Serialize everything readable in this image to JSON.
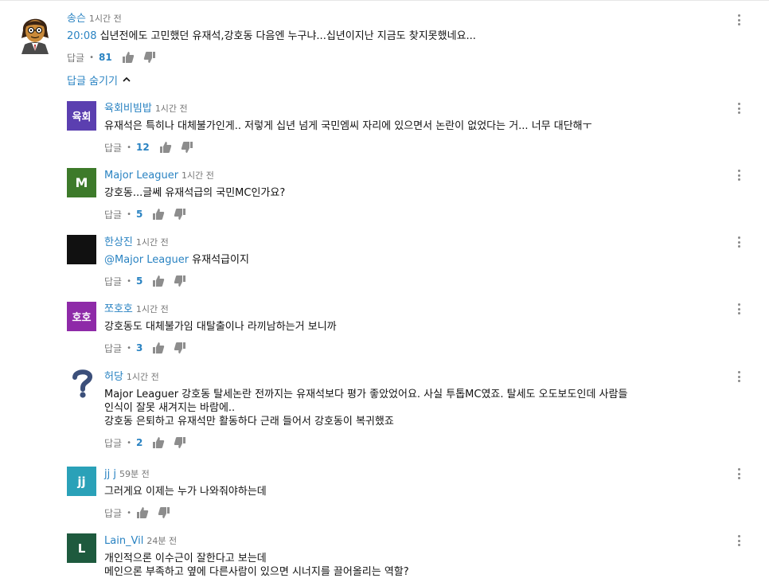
{
  "thread": {
    "author": "송슨",
    "time": "1시간 전",
    "timestamp_link": "20:08",
    "text": " 십년전에도 고민했던 유재석,강호동 다음엔 누구냐...십년이지난 지금도 찾지못했네요...",
    "reply_label": "답글",
    "likes": "81",
    "hide_replies_label": "답글 숨기기"
  },
  "replies": [
    {
      "author": "육회비빔밥",
      "time": "1시간 전",
      "avatar_text": "육회",
      "avatar_color": "#5b3fb0",
      "lines": [
        "유재석은 특히나 대체불가인게.. 저렇게 십년 넘게 국민엠씨 자리에 있으면서 논란이 없었다는 거... 너무 대단해ㅜ"
      ],
      "reply_label": "답글",
      "likes": "12"
    },
    {
      "author": "Major Leaguer",
      "time": "1시간 전",
      "avatar_text": "M",
      "avatar_color": "#3d7a2a",
      "lines": [
        "강호동...글쎄 유재석급의 국민MC인가요?"
      ],
      "reply_label": "답글",
      "likes": "5"
    },
    {
      "author": "한상진",
      "time": "1시간 전",
      "avatar_text": "",
      "avatar_color": "#111111",
      "mention": "@Major Leaguer",
      "lines": [
        " 유재석급이지"
      ],
      "reply_label": "답글",
      "likes": "5"
    },
    {
      "author": "쪼호호",
      "time": "1시간 전",
      "avatar_text": "호호",
      "avatar_color": "#8e2aa8",
      "lines": [
        "강호동도 대체불가임 대탈출이나 라끼남하는거 보니까"
      ],
      "reply_label": "답글",
      "likes": "3"
    },
    {
      "author": "허당",
      "time": "1시간 전",
      "avatar_text": "?",
      "avatar_color": "#ffffff",
      "lines": [
        "Major Leaguer 강호동 탈세논란 전까지는 유재석보다 평가 좋았었어요. 사실 투톱MC였죠. 탈세도 오도보도인데 사람들",
        "인식이 잘못 새겨지는 바람에..",
        "강호동 은퇴하고 유재석만 활동하다 근래 들어서 강호동이 복귀했죠"
      ],
      "reply_label": "답글",
      "likes": "2"
    },
    {
      "author": "jj j",
      "time": "59분 전",
      "avatar_text": "jj",
      "avatar_color": "#2aa1b8",
      "lines": [
        "그러게요 이제는 누가 나와줘야하는데"
      ],
      "reply_label": "답글",
      "likes": ""
    },
    {
      "author": "Lain_Vil",
      "time": "24분 전",
      "avatar_text": "L",
      "avatar_color": "#1e5a3e",
      "lines": [
        "개인적으론 이수근이 잘한다고 보는데",
        "메인으론 부족하고 옆에 다른사람이 있으면 시너지를 끌어올리는 역할?"
      ],
      "reply_label": "답글",
      "likes": ""
    }
  ],
  "icons": {
    "like": "thumbs-up-icon",
    "dislike": "thumbs-down-icon",
    "menu": "kebab-menu-icon",
    "chevron": "chevron-up-icon"
  },
  "colors": {
    "link": "#2a83c2",
    "meta": "#777777"
  }
}
